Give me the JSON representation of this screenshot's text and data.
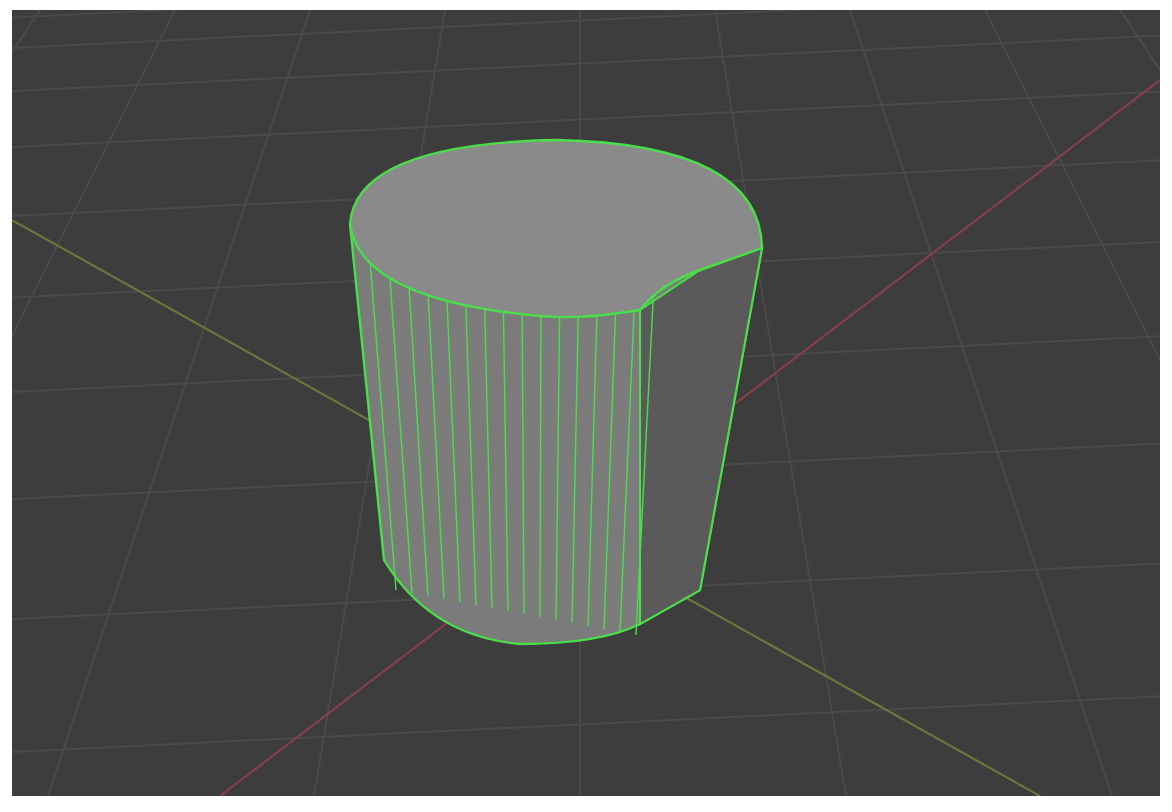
{
  "viewport": {
    "objects": [
      {
        "kind": "cylinder",
        "selected": true
      }
    ]
  }
}
